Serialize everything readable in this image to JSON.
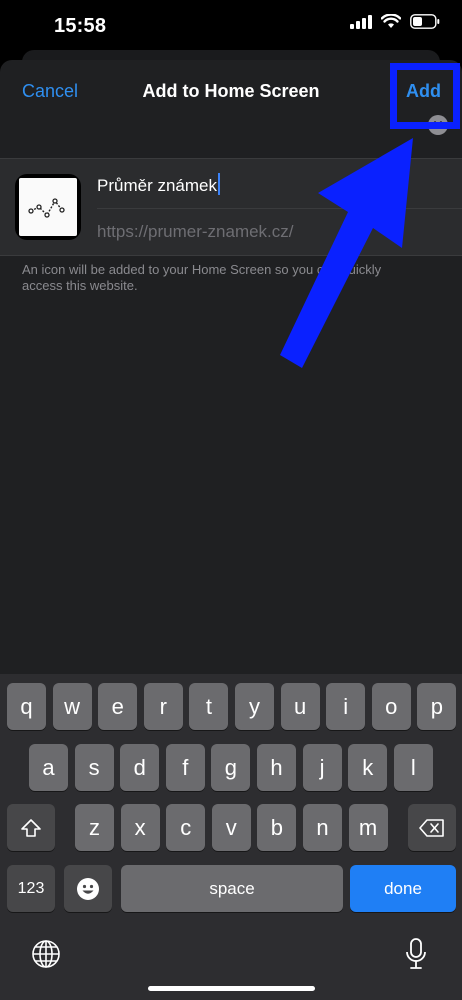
{
  "status_bar": {
    "time": "15:58",
    "icons": [
      "signal-icon",
      "wifi-icon",
      "battery-icon"
    ]
  },
  "nav": {
    "cancel_label": "Cancel",
    "title": "Add to Home Screen",
    "add_label": "Add"
  },
  "bookmark": {
    "name_value": "Průměr známek",
    "url": "https://prumer-znamek.cz/",
    "icon": "chart-line-icon"
  },
  "hint_text": "An icon will be added to your Home Screen so you can quickly access this website.",
  "keyboard": {
    "row1": [
      "q",
      "w",
      "e",
      "r",
      "t",
      "y",
      "u",
      "i",
      "o",
      "p"
    ],
    "row2": [
      "a",
      "s",
      "d",
      "f",
      "g",
      "h",
      "j",
      "k",
      "l"
    ],
    "row3": [
      "z",
      "x",
      "c",
      "v",
      "b",
      "n",
      "m"
    ],
    "numbers_label": "123",
    "space_label": "space",
    "done_label": "done"
  },
  "colors": {
    "accent": "#2f8ff0",
    "sheet": "#1f2022",
    "annotation": "#0a21ff",
    "done_key": "#1f7ff5"
  }
}
